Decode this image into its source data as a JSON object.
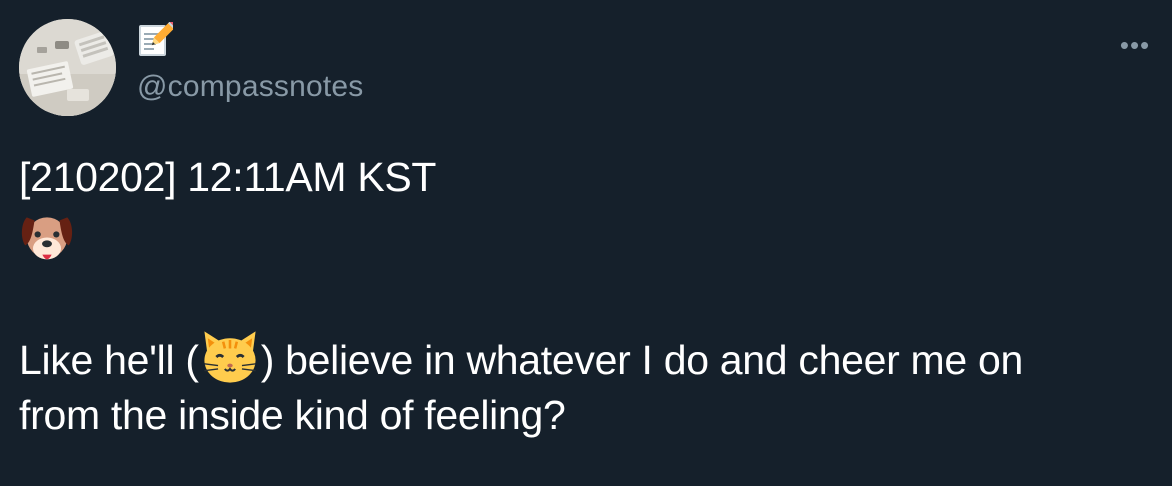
{
  "tweet": {
    "handle": "@compassnotes",
    "name_emoji": "memo-pencil-icon",
    "more_label": "•••",
    "line1": "[210202] 12:11AM KST",
    "line2_emoji": "dog-face-icon",
    "line3_before": "Like he'll (",
    "line3_emoji": "cat-face-icon",
    "line3_after": ") believe in whatever I do and cheer me on",
    "line4": "from the inside kind of feeling?"
  },
  "colors": {
    "background": "#15202b",
    "text": "#ffffff",
    "muted": "#8899a6"
  }
}
